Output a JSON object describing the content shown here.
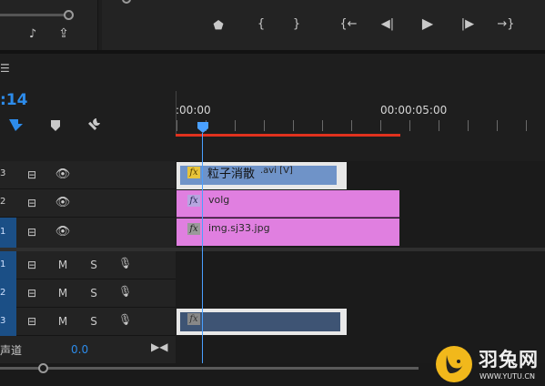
{
  "timecode": ":14",
  "ruler": {
    "start": ":00:00",
    "mark": "00:00:05:00"
  },
  "tracks": {
    "video": [
      {
        "num": "3",
        "selected": false
      },
      {
        "num": "2",
        "selected": false
      },
      {
        "num": "1",
        "selected": true
      }
    ],
    "audio": [
      {
        "num": "1",
        "selected": true,
        "m": "M",
        "s": "S"
      },
      {
        "num": "2",
        "selected": true,
        "m": "M",
        "s": "S"
      },
      {
        "num": "3",
        "selected": true,
        "m": "M",
        "s": "S"
      }
    ]
  },
  "clips": {
    "v3": {
      "label": "粒子消散",
      "suffix": ".avi [V]",
      "fx": "fx"
    },
    "v2": {
      "label": "volg",
      "fx": "fx"
    },
    "v1": {
      "label": "img.sj33.jpg",
      "fx": "fx"
    },
    "a3": {
      "fx": "fx"
    }
  },
  "mix": {
    "label": "声道",
    "value": "0.0"
  },
  "watermark": {
    "name": "羽兔网",
    "url": "WWW.YUTU.CN"
  },
  "colors": {
    "accent_blue": "#2d8ceb",
    "playhead": "#4aa0ff",
    "work_bar": "#e0321e",
    "clip_v3": "#6f93c8",
    "clip_pink": "#e07fe0",
    "clip_audio": "#3e5474",
    "logo_yellow": "#f1b81b"
  }
}
